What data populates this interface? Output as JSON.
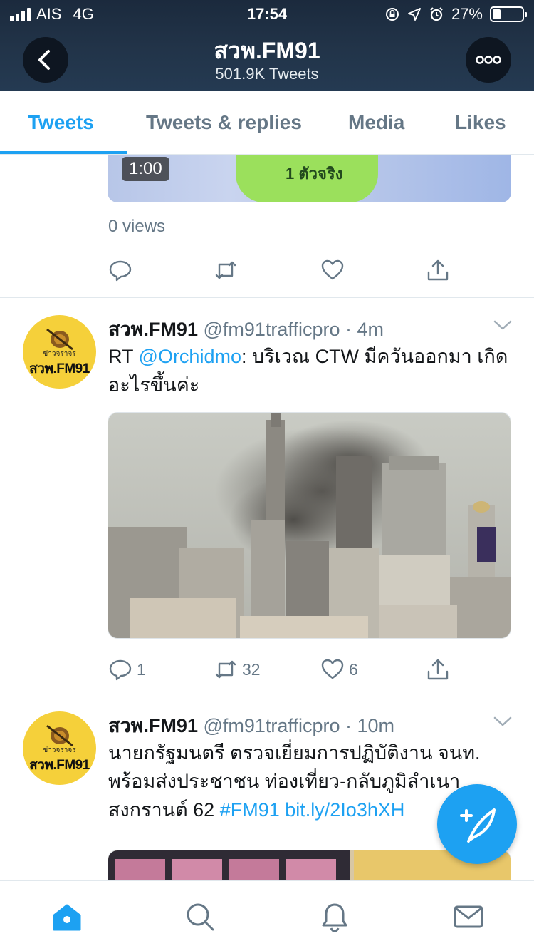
{
  "status_bar": {
    "carrier": "AIS",
    "network": "4G",
    "time": "17:54",
    "battery": "27%",
    "battery_level": 0.27
  },
  "header": {
    "title": "สวพ.FM91",
    "subtitle": "501.9K Tweets"
  },
  "tabs": [
    {
      "label": "Tweets",
      "active": true
    },
    {
      "label": "Tweets & replies",
      "active": false
    },
    {
      "label": "Media",
      "active": false
    },
    {
      "label": "Likes",
      "active": false
    }
  ],
  "tweets": [
    {
      "video_duration": "1:00",
      "video_overlay_text": "1 ตัวจริง",
      "views": "0 views",
      "replies": "",
      "retweets": "",
      "likes": ""
    },
    {
      "name": "สวพ.FM91",
      "handle": "@fm91trafficpro",
      "time": "· 4m",
      "text_prefix": "RT ",
      "mention": "@Orchidmo",
      "text_body": ":   บริเวณ CTW มีควันออกมา เกิดอะไรขึ้นค่ะ",
      "replies": "1",
      "retweets": "32",
      "likes": "6"
    },
    {
      "name": "สวพ.FM91",
      "handle": "@fm91trafficpro",
      "time": "· 10m",
      "text_body": "นายกรัฐมนตรี ตรวจเยี่ยมการปฏิบัติงาน จนท. พร้อมส่งประชาชน ท่องเที่ยว-กลับภูมิลำเนา สงกรานต์ 62 ",
      "hashtag": "#FM91",
      "link": "bit.ly/2Io3hXH"
    }
  ],
  "avatar": {
    "small_text": "ข่าวจราจร",
    "big_text": "สวพ.FM91"
  },
  "colors": {
    "accent": "#1da1f2",
    "header_bg": "#1f3045",
    "secondary_text": "#657786",
    "avatar_bg": "#f5d03a"
  },
  "icons": [
    "back-icon",
    "more-icon",
    "reply-icon",
    "retweet-icon",
    "like-icon",
    "share-icon",
    "chevron-down-icon",
    "compose-icon",
    "home-icon",
    "search-icon",
    "notifications-icon",
    "messages-icon"
  ]
}
